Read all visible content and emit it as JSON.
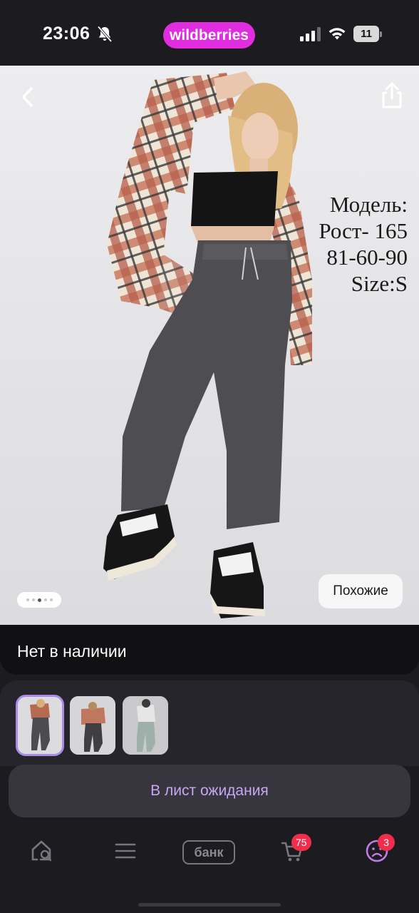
{
  "status_bar": {
    "time": "23:06",
    "brand": "wildberries",
    "battery_level": "11",
    "icons": [
      "bell-slash-icon",
      "signal-icon",
      "wifi-icon",
      "battery-icon"
    ]
  },
  "hero": {
    "back_icon": "chevron-left-icon",
    "share_icon": "share-icon",
    "overlay_lines": [
      "Модель:",
      "Рост- 165",
      "81-60-90",
      "Size:S"
    ],
    "gallery": {
      "count": 5,
      "active_index": 2
    },
    "similar_label": "Похожие"
  },
  "stock": {
    "label": "Нет в наличии"
  },
  "thumbnails": {
    "count": 3,
    "selected_index": 0
  },
  "wait_list": {
    "label": "В лист ожидания"
  },
  "bottom_nav": {
    "items": [
      "home-search-icon",
      "menu-icon",
      "bank-icon",
      "cart-icon",
      "profile-icon"
    ],
    "bank_label": "банк",
    "cart_badge": "75",
    "profile_badge": "3"
  },
  "colors": {
    "background": "#1c1b20",
    "brand": "#e02de0",
    "accent_text": "#c7a6f4",
    "badge": "#f02d4c",
    "thumbnail_selected": "#a98ce8"
  }
}
